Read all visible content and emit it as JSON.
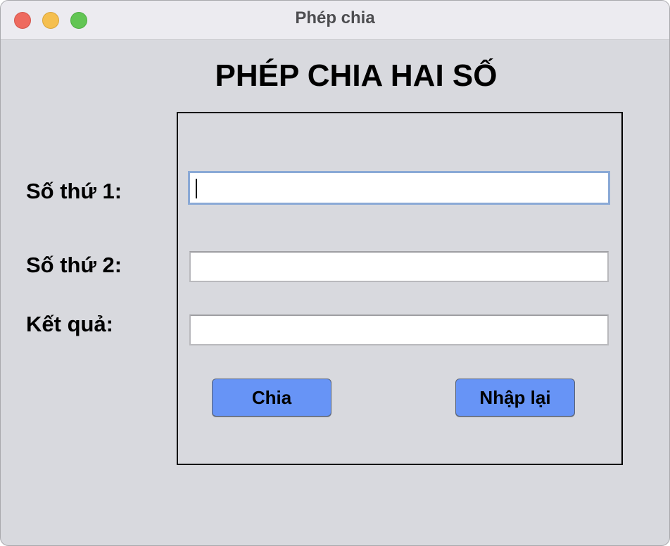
{
  "window": {
    "title": "Phép chia"
  },
  "heading": "PHÉP CHIA HAI SỐ",
  "form": {
    "label_number1": "Số thứ 1:",
    "label_number2": "Số thứ 2:",
    "label_result": "Kết quả:",
    "number1_value": "",
    "number2_value": "",
    "result_value": ""
  },
  "buttons": {
    "divide_label": "Chia",
    "reset_label": "Nhập lại"
  },
  "colors": {
    "window_background": "#d8d9de",
    "button_background": "#6794f6",
    "focus_ring": "#8aa9d6",
    "close": "#ee6a5f",
    "minimize": "#f5bf4f",
    "zoom": "#62c554"
  }
}
